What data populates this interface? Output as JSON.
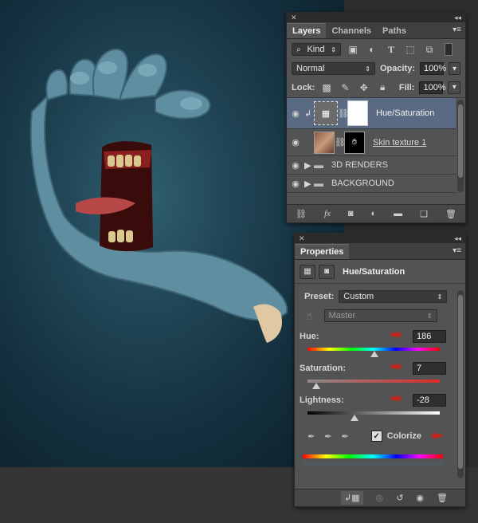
{
  "layers_panel": {
    "tabs": [
      "Layers",
      "Channels",
      "Paths"
    ],
    "filter_kind": "Kind",
    "blend_mode": "Normal",
    "opacity_label": "Opacity:",
    "opacity_value": "100%",
    "lock_label": "Lock:",
    "fill_label": "Fill:",
    "fill_value": "100%",
    "layers": [
      {
        "name": "Hue/Saturation",
        "type": "adjustment",
        "selected": true
      },
      {
        "name": "Skin texture 1",
        "type": "image"
      },
      {
        "name": "3D RENDERS",
        "type": "group"
      },
      {
        "name": "BACKGROUND",
        "type": "group"
      }
    ],
    "footer_icons": [
      "link-icon",
      "fx-icon",
      "mask-icon",
      "adjustment-icon",
      "folder-icon",
      "new-layer-icon",
      "trash-icon"
    ]
  },
  "properties_panel": {
    "tab": "Properties",
    "title": "Hue/Saturation",
    "preset_label": "Preset:",
    "preset_value": "Custom",
    "channel_value": "Master",
    "hue_label": "Hue:",
    "hue_value": "186",
    "saturation_label": "Saturation:",
    "saturation_value": "7",
    "lightness_label": "Lightness:",
    "lightness_value": "-28",
    "colorize_label": "Colorize",
    "colorize_checked": true,
    "footer_icons": [
      "clip-icon",
      "view-previous-icon",
      "reset-icon",
      "visibility-icon",
      "trash-icon"
    ]
  },
  "colors": {
    "panel": "#535353",
    "highlight": "#5a6a82",
    "annotation_arrow": "#c0241b"
  }
}
